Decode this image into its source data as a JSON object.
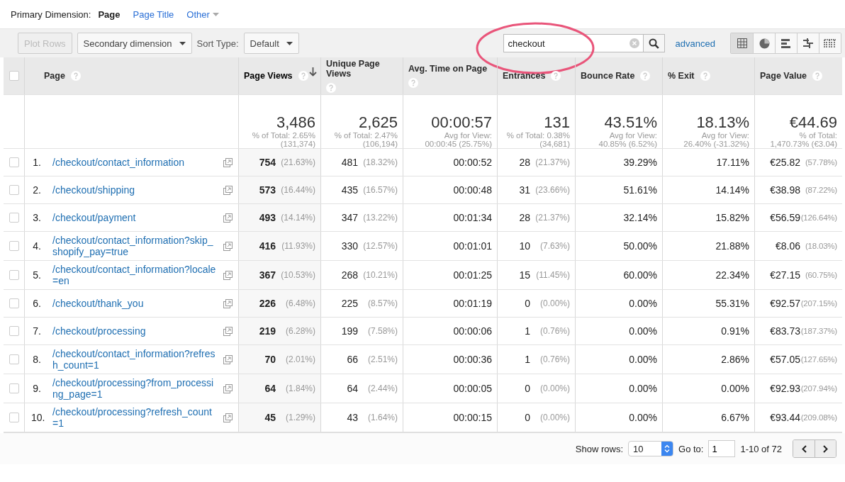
{
  "primary_dimension": {
    "label": "Primary Dimension:",
    "options": [
      {
        "label": "Page",
        "selected": true,
        "has_menu": false
      },
      {
        "label": "Page Title",
        "selected": false,
        "has_menu": false
      },
      {
        "label": "Other",
        "selected": false,
        "has_menu": true
      }
    ]
  },
  "toolbar": {
    "plot_rows": {
      "label": "Plot Rows",
      "disabled": true
    },
    "secondary_dimension": "Secondary dimension",
    "sort_type_label": "Sort Type:",
    "sort_type": "Default",
    "search": {
      "value": "checkout"
    },
    "advanced": "advanced",
    "view_modes": [
      {
        "kind": "table",
        "selected": true
      },
      {
        "kind": "pie",
        "selected": false
      },
      {
        "kind": "bars",
        "selected": false
      },
      {
        "kind": "comparison",
        "selected": false
      },
      {
        "kind": "pivot",
        "selected": false
      }
    ]
  },
  "table": {
    "select_all_checked": false,
    "columns": [
      {
        "label": "Page",
        "sorted": false
      },
      {
        "label": "Page Views",
        "sorted": true
      },
      {
        "label": "Unique Page Views",
        "sorted": false
      },
      {
        "label": "Avg. Time on Page",
        "sorted": false
      },
      {
        "label": "Entrances",
        "sorted": false
      },
      {
        "label": "Bounce Rate",
        "sorted": false
      },
      {
        "label": "% Exit",
        "sorted": false
      },
      {
        "label": "Page Value",
        "sorted": false
      }
    ],
    "summary": [
      {
        "value": "3,486",
        "lines": [
          "% of Total: 2.65%",
          "(131,374)"
        ]
      },
      {
        "value": "2,625",
        "lines": [
          "% of Total: 2.47%",
          "(106,194)"
        ]
      },
      {
        "value": "00:00:57",
        "lines": [
          "Avg for View:",
          "00:00:45 (25.75%)"
        ]
      },
      {
        "value": "131",
        "lines": [
          "% of Total: 0.38%",
          "(34,681)"
        ]
      },
      {
        "value": "43.51%",
        "lines": [
          "Avg for View:",
          "40.85% (6.52%)"
        ]
      },
      {
        "value": "18.13%",
        "lines": [
          "Avg for View:",
          "26.40% (-31.32%)"
        ]
      },
      {
        "value": "€44.69",
        "lines": [
          "% of Total:",
          "1,470.73% (€3.04)"
        ]
      }
    ],
    "rows": [
      {
        "checked": false,
        "index": "1.",
        "page": "/checkout/contact_information",
        "page_views": "754",
        "page_views_pct": "(21.63%)",
        "unique": "481",
        "unique_pct": "(18.32%)",
        "avg_time": "00:00:52",
        "entrances": "28",
        "entrances_pct": "(21.37%)",
        "bounce": "39.29%",
        "exit": "17.11%",
        "value": "€25.82",
        "value_pct": "(57.78%)"
      },
      {
        "checked": false,
        "index": "2.",
        "page": "/checkout/shipping",
        "page_views": "573",
        "page_views_pct": "(16.44%)",
        "unique": "435",
        "unique_pct": "(16.57%)",
        "avg_time": "00:00:48",
        "entrances": "31",
        "entrances_pct": "(23.66%)",
        "bounce": "51.61%",
        "exit": "14.14%",
        "value": "€38.98",
        "value_pct": "(87.22%)"
      },
      {
        "checked": false,
        "index": "3.",
        "page": "/checkout/payment",
        "page_views": "493",
        "page_views_pct": "(14.14%)",
        "unique": "347",
        "unique_pct": "(13.22%)",
        "avg_time": "00:01:34",
        "entrances": "28",
        "entrances_pct": "(21.37%)",
        "bounce": "32.14%",
        "exit": "15.82%",
        "value": "€56.59",
        "value_pct": "(126.64%)"
      },
      {
        "checked": false,
        "index": "4.",
        "page": "/checkout/contact_information?skip_shopify_pay=true",
        "page_views": "416",
        "page_views_pct": "(11.93%)",
        "unique": "330",
        "unique_pct": "(12.57%)",
        "avg_time": "00:01:01",
        "entrances": "10",
        "entrances_pct": "(7.63%)",
        "bounce": "50.00%",
        "exit": "21.88%",
        "value": "€8.06",
        "value_pct": "(18.03%)"
      },
      {
        "checked": false,
        "index": "5.",
        "page": "/checkout/contact_information?locale=en",
        "page_views": "367",
        "page_views_pct": "(10.53%)",
        "unique": "268",
        "unique_pct": "(10.21%)",
        "avg_time": "00:01:25",
        "entrances": "15",
        "entrances_pct": "(11.45%)",
        "bounce": "60.00%",
        "exit": "22.34%",
        "value": "€27.15",
        "value_pct": "(60.75%)"
      },
      {
        "checked": false,
        "index": "6.",
        "page": "/checkout/thank_you",
        "page_views": "226",
        "page_views_pct": "(6.48%)",
        "unique": "225",
        "unique_pct": "(8.57%)",
        "avg_time": "00:01:19",
        "entrances": "0",
        "entrances_pct": "(0.00%)",
        "bounce": "0.00%",
        "exit": "55.31%",
        "value": "€92.57",
        "value_pct": "(207.15%)"
      },
      {
        "checked": false,
        "index": "7.",
        "page": "/checkout/processing",
        "page_views": "219",
        "page_views_pct": "(6.28%)",
        "unique": "199",
        "unique_pct": "(7.58%)",
        "avg_time": "00:00:06",
        "entrances": "1",
        "entrances_pct": "(0.76%)",
        "bounce": "0.00%",
        "exit": "0.91%",
        "value": "€83.73",
        "value_pct": "(187.37%)"
      },
      {
        "checked": false,
        "index": "8.",
        "page": "/checkout/contact_information?refresh_count=1",
        "page_views": "70",
        "page_views_pct": "(2.01%)",
        "unique": "66",
        "unique_pct": "(2.51%)",
        "avg_time": "00:00:36",
        "entrances": "1",
        "entrances_pct": "(0.76%)",
        "bounce": "0.00%",
        "exit": "2.86%",
        "value": "€57.05",
        "value_pct": "(127.65%)"
      },
      {
        "checked": false,
        "index": "9.",
        "page": "/checkout/processing?from_processing_page=1",
        "page_views": "64",
        "page_views_pct": "(1.84%)",
        "unique": "64",
        "unique_pct": "(2.44%)",
        "avg_time": "00:00:05",
        "entrances": "0",
        "entrances_pct": "(0.00%)",
        "bounce": "0.00%",
        "exit": "0.00%",
        "value": "€92.93",
        "value_pct": "(207.94%)"
      },
      {
        "checked": false,
        "index": "10.",
        "page": "/checkout/processing?refresh_count=1",
        "page_views": "45",
        "page_views_pct": "(1.29%)",
        "unique": "43",
        "unique_pct": "(1.64%)",
        "avg_time": "00:00:15",
        "entrances": "0",
        "entrances_pct": "(0.00%)",
        "bounce": "0.00%",
        "exit": "6.67%",
        "value": "€93.44",
        "value_pct": "(209.08%)"
      }
    ]
  },
  "pagination": {
    "show_rows_label": "Show rows:",
    "show_rows": "10",
    "goto_label": "Go to:",
    "goto": "1",
    "range": "1-10 of 72"
  }
}
